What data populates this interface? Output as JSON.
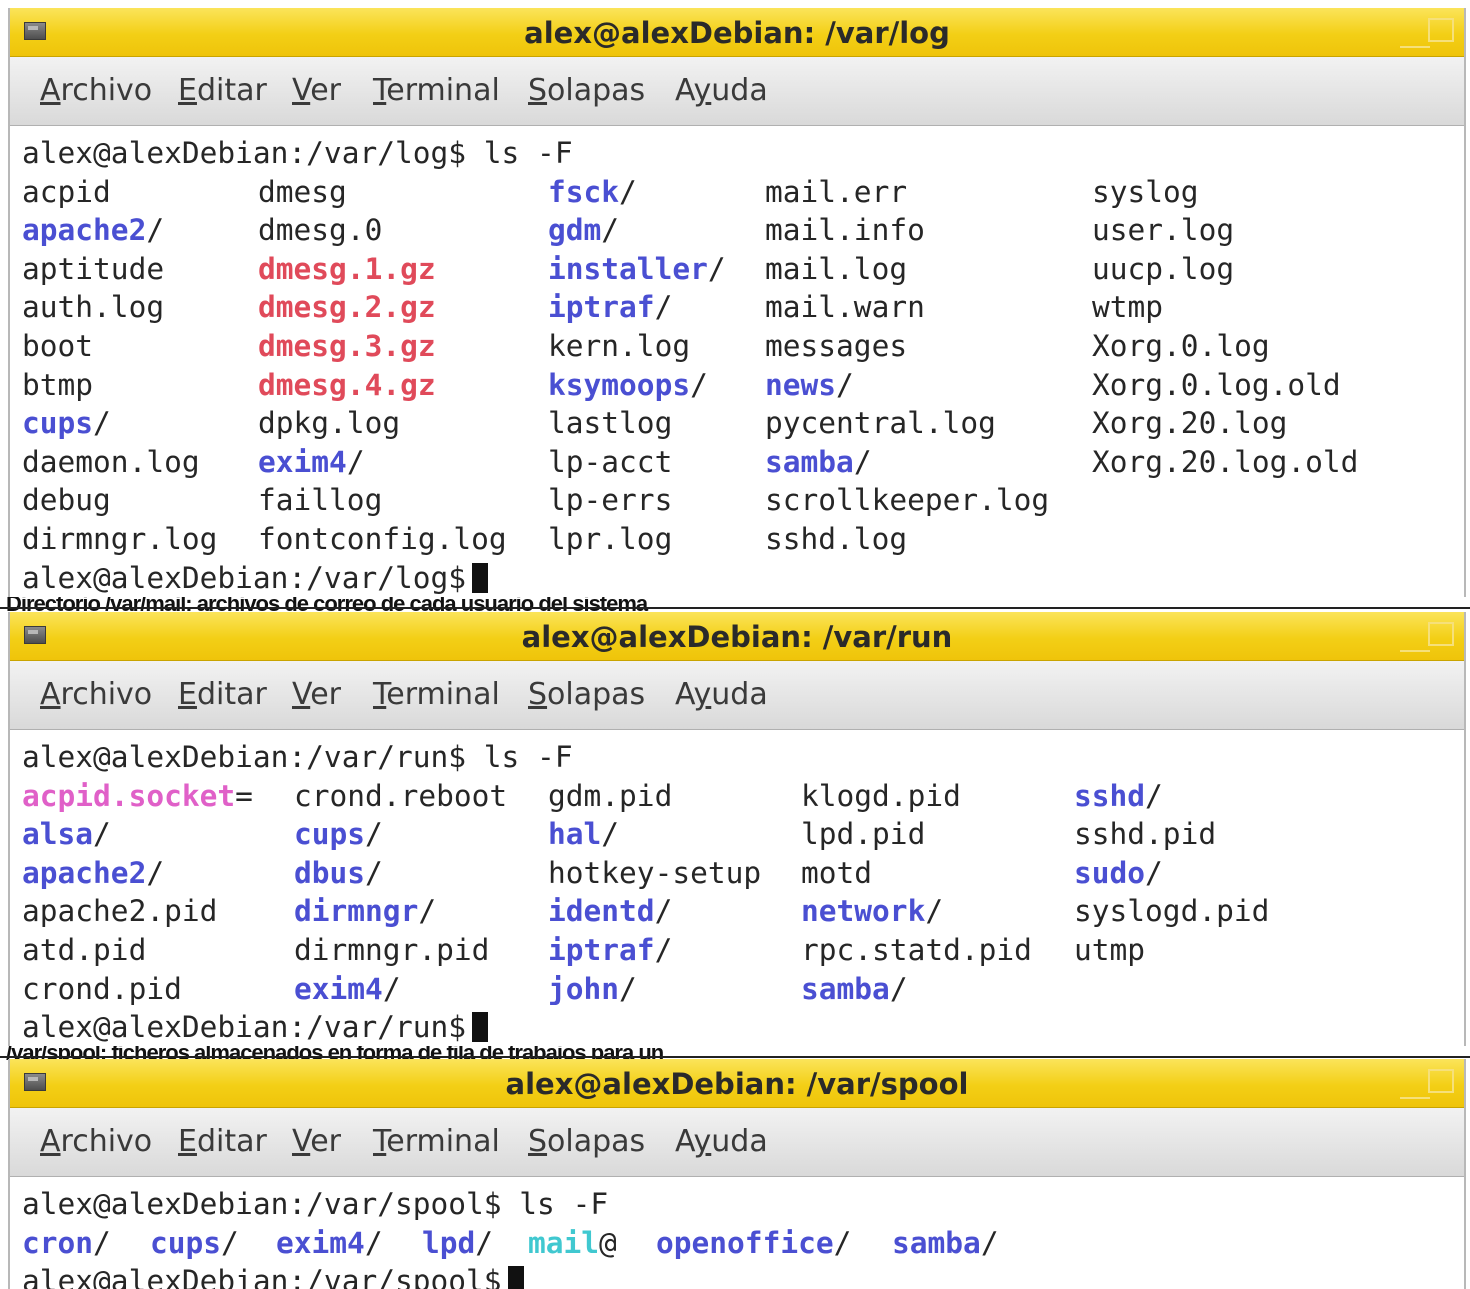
{
  "windows": [
    {
      "title": "alex@alexDebian: /var/log",
      "menu": [
        "Archivo",
        "Editar",
        "Ver",
        "Terminal",
        "Solapas",
        "Ayuda"
      ],
      "command_prompt": "alex@alexDebian:/var/log$ ls -F",
      "end_prompt": "alex@alexDebian:/var/log$",
      "columns": [
        [
          {
            "name": "acpid",
            "type": "plain"
          },
          {
            "name": "apache2",
            "suffix": "/",
            "type": "dir"
          },
          {
            "name": "aptitude",
            "type": "plain"
          },
          {
            "name": "auth.log",
            "type": "plain"
          },
          {
            "name": "boot",
            "type": "plain"
          },
          {
            "name": "btmp",
            "type": "plain"
          },
          {
            "name": "cups",
            "suffix": "/",
            "type": "dir"
          },
          {
            "name": "daemon.log",
            "type": "plain"
          },
          {
            "name": "debug",
            "type": "plain"
          },
          {
            "name": "dirmngr.log",
            "type": "plain"
          }
        ],
        [
          {
            "name": "dmesg",
            "type": "plain"
          },
          {
            "name": "dmesg.0",
            "type": "plain"
          },
          {
            "name": "dmesg.1.gz",
            "type": "gz"
          },
          {
            "name": "dmesg.2.gz",
            "type": "gz"
          },
          {
            "name": "dmesg.3.gz",
            "type": "gz"
          },
          {
            "name": "dmesg.4.gz",
            "type": "gz"
          },
          {
            "name": "dpkg.log",
            "type": "plain"
          },
          {
            "name": "exim4",
            "suffix": "/",
            "type": "dir"
          },
          {
            "name": "faillog",
            "type": "plain"
          },
          {
            "name": "fontconfig.log",
            "type": "plain"
          }
        ],
        [
          {
            "name": "fsck",
            "suffix": "/",
            "type": "dir"
          },
          {
            "name": "gdm",
            "suffix": "/",
            "type": "dir"
          },
          {
            "name": "installer",
            "suffix": "/",
            "type": "dir"
          },
          {
            "name": "iptraf",
            "suffix": "/",
            "type": "dir"
          },
          {
            "name": "kern.log",
            "type": "plain"
          },
          {
            "name": "ksymoops",
            "suffix": "/",
            "type": "dir"
          },
          {
            "name": "lastlog",
            "type": "plain"
          },
          {
            "name": "lp-acct",
            "type": "plain"
          },
          {
            "name": "lp-errs",
            "type": "plain"
          },
          {
            "name": "lpr.log",
            "type": "plain"
          }
        ],
        [
          {
            "name": "mail.err",
            "type": "plain"
          },
          {
            "name": "mail.info",
            "type": "plain"
          },
          {
            "name": "mail.log",
            "type": "plain"
          },
          {
            "name": "mail.warn",
            "type": "plain"
          },
          {
            "name": "messages",
            "type": "plain"
          },
          {
            "name": "news",
            "suffix": "/",
            "type": "dir"
          },
          {
            "name": "pycentral.log",
            "type": "plain"
          },
          {
            "name": "samba",
            "suffix": "/",
            "type": "dir"
          },
          {
            "name": "scrollkeeper.log",
            "type": "plain"
          },
          {
            "name": "sshd.log",
            "type": "plain"
          }
        ],
        [
          {
            "name": "syslog",
            "type": "plain"
          },
          {
            "name": "user.log",
            "type": "plain"
          },
          {
            "name": "uucp.log",
            "type": "plain"
          },
          {
            "name": "wtmp",
            "type": "plain"
          },
          {
            "name": "Xorg.0.log",
            "type": "plain"
          },
          {
            "name": "Xorg.0.log.old",
            "type": "plain"
          },
          {
            "name": "Xorg.20.log",
            "type": "plain"
          },
          {
            "name": "Xorg.20.log.old",
            "type": "plain"
          }
        ]
      ]
    },
    {
      "title": "alex@alexDebian: /var/run",
      "menu": [
        "Archivo",
        "Editar",
        "Ver",
        "Terminal",
        "Solapas",
        "Ayuda"
      ],
      "command_prompt": "alex@alexDebian:/var/run$ ls -F",
      "end_prompt": "alex@alexDebian:/var/run$",
      "columns": [
        [
          {
            "name": "acpid.socket",
            "suffix": "=",
            "type": "sock"
          },
          {
            "name": "alsa",
            "suffix": "/",
            "type": "dir"
          },
          {
            "name": "apache2",
            "suffix": "/",
            "type": "dir"
          },
          {
            "name": "apache2.pid",
            "type": "plain"
          },
          {
            "name": "atd.pid",
            "type": "plain"
          },
          {
            "name": "crond.pid",
            "type": "plain"
          }
        ],
        [
          {
            "name": "crond.reboot",
            "type": "plain"
          },
          {
            "name": "cups",
            "suffix": "/",
            "type": "dir"
          },
          {
            "name": "dbus",
            "suffix": "/",
            "type": "dir"
          },
          {
            "name": "dirmngr",
            "suffix": "/",
            "type": "dir"
          },
          {
            "name": "dirmngr.pid",
            "type": "plain"
          },
          {
            "name": "exim4",
            "suffix": "/",
            "type": "dir"
          }
        ],
        [
          {
            "name": "gdm.pid",
            "type": "plain"
          },
          {
            "name": "hal",
            "suffix": "/",
            "type": "dir"
          },
          {
            "name": "hotkey-setup",
            "type": "plain"
          },
          {
            "name": "identd",
            "suffix": "/",
            "type": "dir"
          },
          {
            "name": "iptraf",
            "suffix": "/",
            "type": "dir"
          },
          {
            "name": "john",
            "suffix": "/",
            "type": "dir"
          }
        ],
        [
          {
            "name": "klogd.pid",
            "type": "plain"
          },
          {
            "name": "lpd.pid",
            "type": "plain"
          },
          {
            "name": "motd",
            "type": "plain"
          },
          {
            "name": "network",
            "suffix": "/",
            "type": "dir"
          },
          {
            "name": "rpc.statd.pid",
            "type": "plain"
          },
          {
            "name": "samba",
            "suffix": "/",
            "type": "dir"
          }
        ],
        [
          {
            "name": "sshd",
            "suffix": "/",
            "type": "dir"
          },
          {
            "name": "sshd.pid",
            "type": "plain"
          },
          {
            "name": "sudo",
            "suffix": "/",
            "type": "dir"
          },
          {
            "name": "syslogd.pid",
            "type": "plain"
          },
          {
            "name": "utmp",
            "type": "plain"
          }
        ]
      ]
    },
    {
      "title": "alex@alexDebian: /var/spool",
      "menu": [
        "Archivo",
        "Editar",
        "Ver",
        "Terminal",
        "Solapas",
        "Ayuda"
      ],
      "command_prompt": "alex@alexDebian:/var/spool$ ls -F",
      "end_prompt": "alex@alexDebian:/var/spool$",
      "columns": [
        [
          {
            "name": "cron",
            "suffix": "/",
            "type": "dir"
          }
        ],
        [
          {
            "name": "cups",
            "suffix": "/",
            "type": "dir"
          }
        ],
        [
          {
            "name": "exim4",
            "suffix": "/",
            "type": "dir"
          }
        ],
        [
          {
            "name": "lpd",
            "suffix": "/",
            "type": "dir"
          }
        ],
        [
          {
            "name": "mail",
            "suffix": "@",
            "type": "link"
          }
        ],
        [
          {
            "name": "openoffice",
            "suffix": "/",
            "type": "dir"
          }
        ],
        [
          {
            "name": "samba",
            "suffix": "/",
            "type": "dir"
          }
        ]
      ]
    }
  ],
  "separators": [
    "Directorio /var/mail: archivos de correo de cada usuario del sistema",
    "/var/spool: ficheros almacenados en forma de fila de trabajos para un"
  ]
}
